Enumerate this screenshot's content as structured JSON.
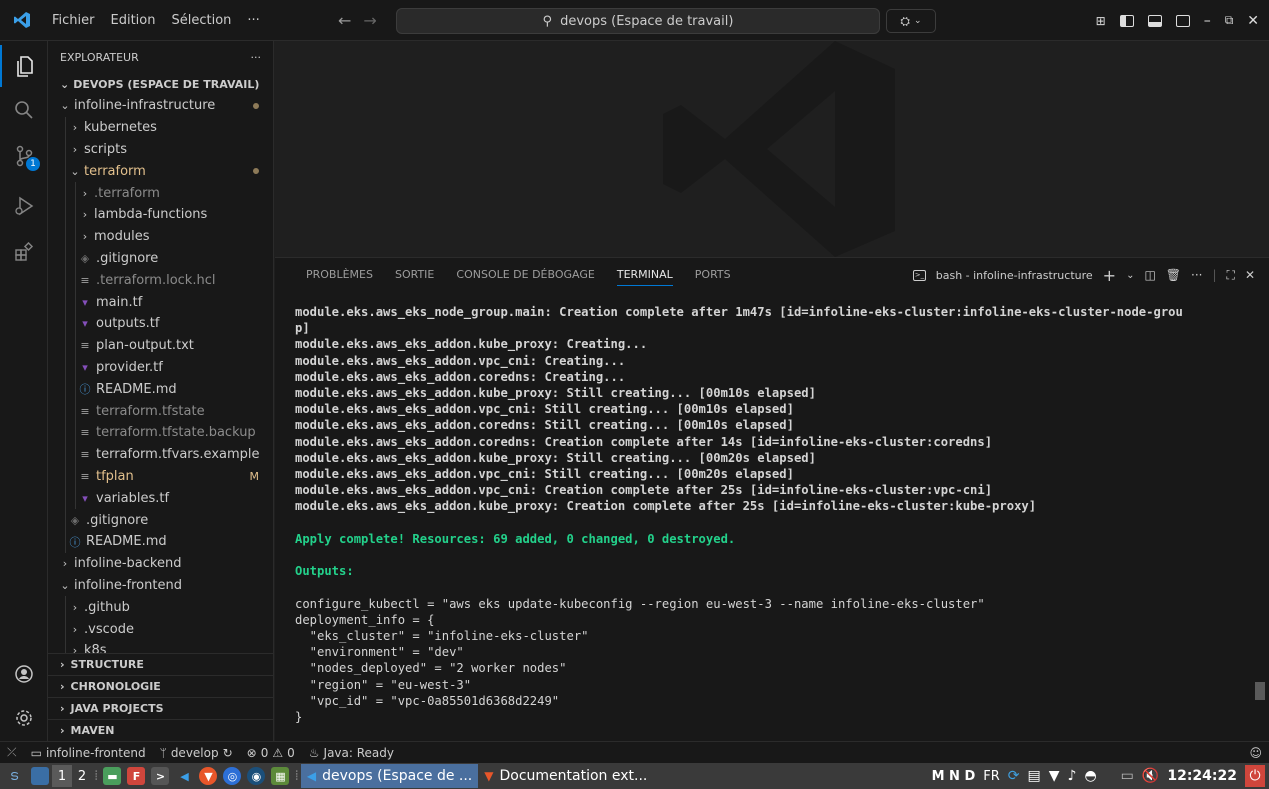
{
  "menu": {
    "items": [
      "Fichier",
      "Edition",
      "Sélection",
      "···"
    ]
  },
  "titlebar": {
    "search_text": "devops (Espace de travail)"
  },
  "activity": {
    "scm_badge": "1"
  },
  "sidebar": {
    "title": "EXPLORATEUR",
    "more": "···",
    "workspace": "DEVOPS (ESPACE DE TRAVAIL)",
    "tree": [
      {
        "label": "infoline-infrastructure",
        "depth": 0,
        "chev": "⌄",
        "dot": true
      },
      {
        "label": "kubernetes",
        "depth": 1,
        "chev": "›"
      },
      {
        "label": "scripts",
        "depth": 1,
        "chev": "›"
      },
      {
        "label": "terraform",
        "depth": 1,
        "chev": "⌄",
        "dot": true,
        "cls": "mod"
      },
      {
        "label": ".terraform",
        "depth": 2,
        "chev": "›",
        "cls": "dim"
      },
      {
        "label": "lambda-functions",
        "depth": 2,
        "chev": "›"
      },
      {
        "label": "modules",
        "depth": 2,
        "chev": "›"
      },
      {
        "label": ".gitignore",
        "depth": 2,
        "icon": "git"
      },
      {
        "label": ".terraform.lock.hcl",
        "depth": 2,
        "icon": "lines",
        "cls": "dim"
      },
      {
        "label": "main.tf",
        "depth": 2,
        "icon": "tf"
      },
      {
        "label": "outputs.tf",
        "depth": 2,
        "icon": "tf"
      },
      {
        "label": "plan-output.txt",
        "depth": 2,
        "icon": "lines"
      },
      {
        "label": "provider.tf",
        "depth": 2,
        "icon": "tf"
      },
      {
        "label": "README.md",
        "depth": 2,
        "icon": "info"
      },
      {
        "label": "terraform.tfstate",
        "depth": 2,
        "icon": "lines",
        "cls": "dim"
      },
      {
        "label": "terraform.tfstate.backup",
        "depth": 2,
        "icon": "lines",
        "cls": "dim"
      },
      {
        "label": "terraform.tfvars.example",
        "depth": 2,
        "icon": "lines"
      },
      {
        "label": "tfplan",
        "depth": 2,
        "icon": "lines",
        "cls": "mod",
        "mark": "M"
      },
      {
        "label": "variables.tf",
        "depth": 2,
        "icon": "tf"
      },
      {
        "label": ".gitignore",
        "depth": 1,
        "icon": "git"
      },
      {
        "label": "README.md",
        "depth": 1,
        "icon": "info"
      },
      {
        "label": "infoline-backend",
        "depth": 0,
        "chev": "›"
      },
      {
        "label": "infoline-frontend",
        "depth": 0,
        "chev": "⌄"
      },
      {
        "label": ".github",
        "depth": 1,
        "chev": "›"
      },
      {
        "label": ".vscode",
        "depth": 1,
        "chev": "›"
      },
      {
        "label": "k8s",
        "depth": 1,
        "chev": "›"
      }
    ],
    "sections": [
      "STRUCTURE",
      "CHRONOLOGIE",
      "JAVA PROJECTS",
      "MAVEN"
    ]
  },
  "panel": {
    "tabs": [
      "PROBLÈMES",
      "SORTIE",
      "CONSOLE DE DÉBOGAGE",
      "TERMINAL",
      "PORTS"
    ],
    "active_tab": 3,
    "terminal_name": "bash - infoline-infrastructure"
  },
  "terminal": {
    "lines": [
      {
        "t": "module.eks.aws_eks_node_group.main: Creation complete after 1m47s [id=infoline-eks-cluster:infoline-eks-cluster-node-grou",
        "c": "bold"
      },
      {
        "t": "p]",
        "c": "bold"
      },
      {
        "t": "module.eks.aws_eks_addon.kube_proxy: Creating...",
        "c": "bold"
      },
      {
        "t": "module.eks.aws_eks_addon.vpc_cni: Creating...",
        "c": "bold"
      },
      {
        "t": "module.eks.aws_eks_addon.coredns: Creating...",
        "c": "bold"
      },
      {
        "t": "module.eks.aws_eks_addon.kube_proxy: Still creating... [00m10s elapsed]",
        "c": "bold"
      },
      {
        "t": "module.eks.aws_eks_addon.vpc_cni: Still creating... [00m10s elapsed]",
        "c": "bold"
      },
      {
        "t": "module.eks.aws_eks_addon.coredns: Still creating... [00m10s elapsed]",
        "c": "bold"
      },
      {
        "t": "module.eks.aws_eks_addon.coredns: Creation complete after 14s [id=infoline-eks-cluster:coredns]",
        "c": "bold"
      },
      {
        "t": "module.eks.aws_eks_addon.kube_proxy: Still creating... [00m20s elapsed]",
        "c": "bold"
      },
      {
        "t": "module.eks.aws_eks_addon.vpc_cni: Still creating... [00m20s elapsed]",
        "c": "bold"
      },
      {
        "t": "module.eks.aws_eks_addon.vpc_cni: Creation complete after 25s [id=infoline-eks-cluster:vpc-cni]",
        "c": "bold"
      },
      {
        "t": "module.eks.aws_eks_addon.kube_proxy: Creation complete after 25s [id=infoline-eks-cluster:kube-proxy]",
        "c": "bold"
      },
      {
        "t": "",
        "c": ""
      },
      {
        "t": "Apply complete! Resources: 69 added, 0 changed, 0 destroyed.",
        "c": "ok"
      },
      {
        "t": "",
        "c": ""
      },
      {
        "t": "Outputs:",
        "c": "ok"
      },
      {
        "t": "",
        "c": ""
      },
      {
        "t": "configure_kubectl = \"aws eks update-kubeconfig --region eu-west-3 --name infoline-eks-cluster\"",
        "c": ""
      },
      {
        "t": "deployment_info = {",
        "c": ""
      },
      {
        "t": "  \"eks_cluster\" = \"infoline-eks-cluster\"",
        "c": ""
      },
      {
        "t": "  \"environment\" = \"dev\"",
        "c": ""
      },
      {
        "t": "  \"nodes_deployed\" = \"2 worker nodes\"",
        "c": ""
      },
      {
        "t": "  \"region\" = \"eu-west-3\"",
        "c": ""
      },
      {
        "t": "  \"vpc_id\" = \"vpc-0a85501d6368d2249\"",
        "c": ""
      },
      {
        "t": "}",
        "c": ""
      }
    ]
  },
  "statusbar": {
    "project": "infoline-frontend",
    "branch": "develop",
    "errors": "0",
    "warnings": "0",
    "java_status": "Java: Ready"
  },
  "taskbar": {
    "workspaces": [
      "1",
      "2"
    ],
    "windows": [
      "devops (Espace de ...",
      "Documentation ext..."
    ],
    "indicators": "M N D",
    "lang": "FR",
    "clock": "12:24:22"
  },
  "colors": {
    "accent": "#0078d4",
    "terminal_success": "#23d18b",
    "modified": "#e2c08d",
    "terraform": "#844fba"
  }
}
